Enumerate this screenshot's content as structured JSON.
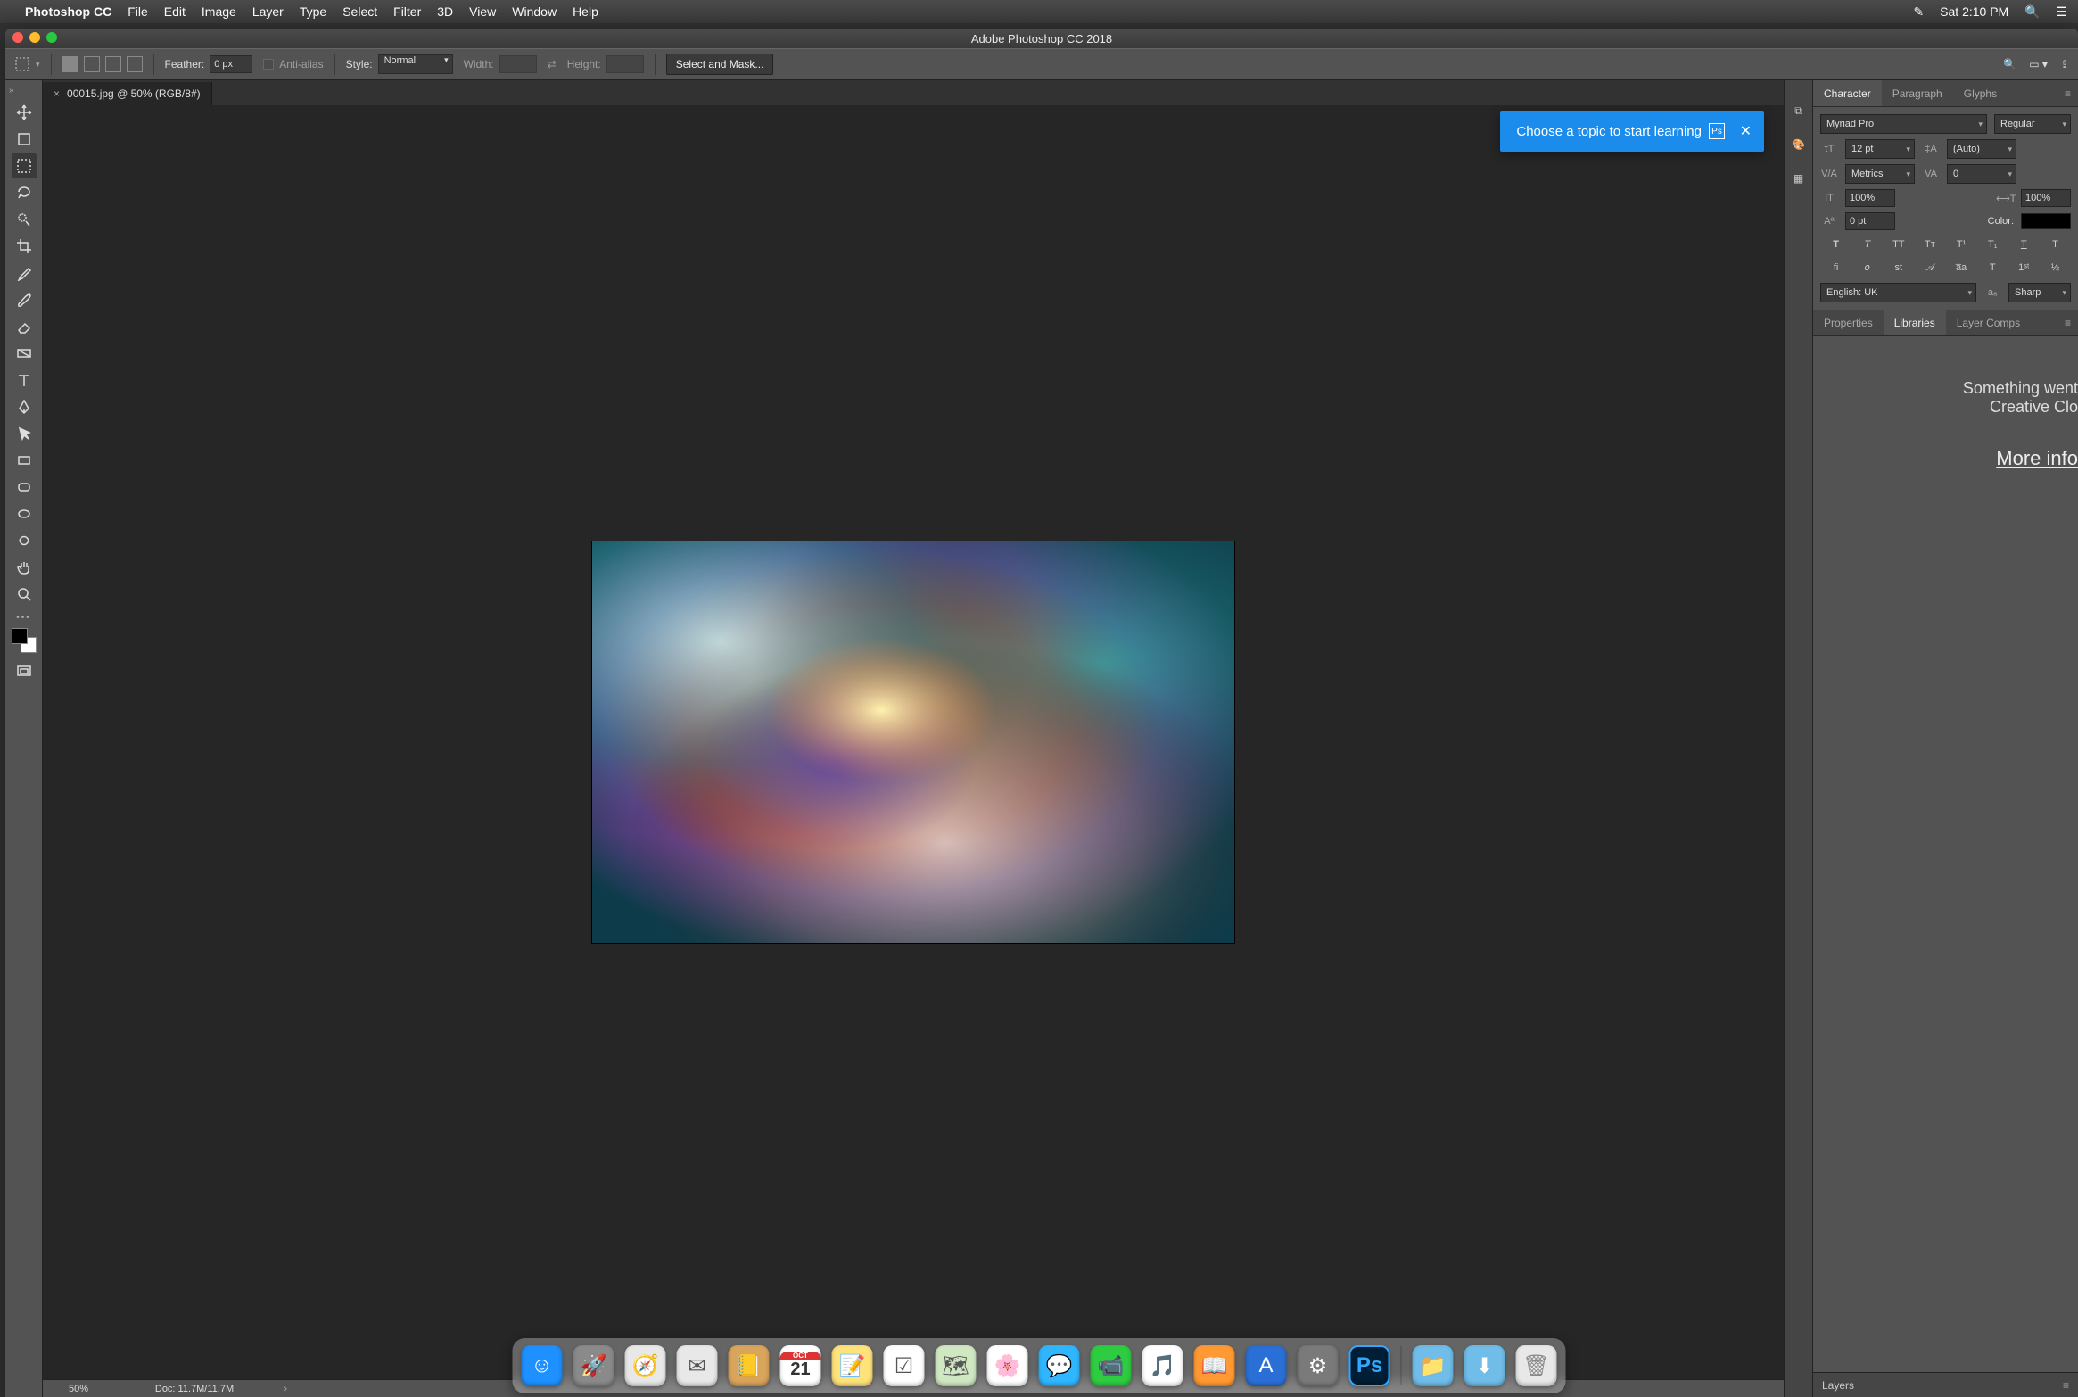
{
  "mac_menu": {
    "app": "Photoshop CC",
    "items": [
      "File",
      "Edit",
      "Image",
      "Layer",
      "Type",
      "Select",
      "Filter",
      "3D",
      "View",
      "Window",
      "Help"
    ],
    "clock": "Sat 2:10 PM"
  },
  "window": {
    "title": "Adobe Photoshop CC 2018"
  },
  "options_bar": {
    "feather_label": "Feather:",
    "feather_value": "0 px",
    "antialias_label": "Anti-alias",
    "style_label": "Style:",
    "style_value": "Normal",
    "width_label": "Width:",
    "height_label": "Height:",
    "select_mask_btn": "Select and Mask..."
  },
  "document_tab": {
    "label": "00015.jpg @ 50% (RGB/8#)"
  },
  "learn_tooltip": {
    "text": "Choose a topic to start learning",
    "badge": "Ps"
  },
  "status_bar": {
    "zoom": "50%",
    "doc": "Doc: 11.7M/11.7M"
  },
  "char_panel": {
    "tabs": [
      "Character",
      "Paragraph",
      "Glyphs"
    ],
    "font_family": "Myriad Pro",
    "font_style": "Regular",
    "size": "12 pt",
    "leading": "(Auto)",
    "kerning": "Metrics",
    "tracking": "0",
    "vscale": "100%",
    "hscale": "100%",
    "baseline": "0 pt",
    "color_label": "Color:",
    "language": "English: UK",
    "aa": "Sharp"
  },
  "lib_panel": {
    "tabs": [
      "Properties",
      "Libraries",
      "Layer Comps"
    ],
    "line1": "Something went",
    "line2": "Creative Clo",
    "link": "More info"
  },
  "layers_panel": {
    "title": "Layers"
  },
  "dock_items": [
    {
      "name": "finder",
      "bg": "#1e90ff",
      "glyph": "☺"
    },
    {
      "name": "launchpad",
      "bg": "#8a8a8a",
      "glyph": "🚀"
    },
    {
      "name": "safari",
      "bg": "#e8e8e8",
      "glyph": "🧭"
    },
    {
      "name": "mail",
      "bg": "#e8e8e8",
      "glyph": "✉"
    },
    {
      "name": "contacts",
      "bg": "#d9a45b",
      "glyph": "📒"
    },
    {
      "name": "calendar",
      "bg": "#fff",
      "glyph": "21"
    },
    {
      "name": "notes",
      "bg": "#ffe27a",
      "glyph": "📝"
    },
    {
      "name": "reminders",
      "bg": "#fff",
      "glyph": "☑"
    },
    {
      "name": "maps",
      "bg": "#cfe8c2",
      "glyph": "🗺"
    },
    {
      "name": "photos",
      "bg": "#fff",
      "glyph": "🌸"
    },
    {
      "name": "messages",
      "bg": "#2fb6ff",
      "glyph": "💬"
    },
    {
      "name": "facetime",
      "bg": "#2ecc40",
      "glyph": "📹"
    },
    {
      "name": "itunes",
      "bg": "#fff",
      "glyph": "🎵"
    },
    {
      "name": "ibooks",
      "bg": "#ff9933",
      "glyph": "📖"
    },
    {
      "name": "appstore",
      "bg": "#2a6fd6",
      "glyph": "A"
    },
    {
      "name": "preferences",
      "bg": "#7a7a7a",
      "glyph": "⚙"
    },
    {
      "name": "photoshop",
      "bg": "#001e36",
      "glyph": "Ps"
    }
  ],
  "dock_right": [
    {
      "name": "apps-folder",
      "bg": "#6fbde8",
      "glyph": "📁"
    },
    {
      "name": "downloads",
      "bg": "#6fbde8",
      "glyph": "⬇"
    },
    {
      "name": "trash",
      "bg": "#e8e8e8",
      "glyph": "🗑"
    }
  ]
}
